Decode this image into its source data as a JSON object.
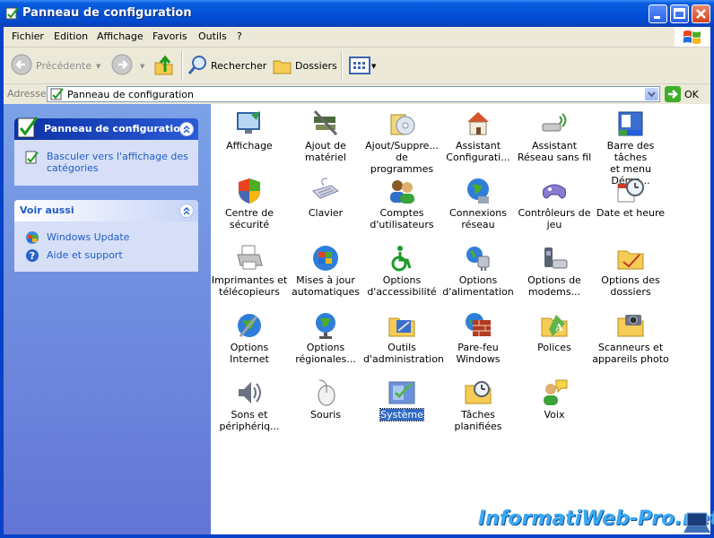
{
  "window": {
    "title": "Panneau de configuration"
  },
  "menu": [
    "Fichier",
    "Edition",
    "Affichage",
    "Favoris",
    "Outils",
    "?"
  ],
  "toolbar": {
    "back_label": "Précédente",
    "search_label": "Rechercher",
    "folders_label": "Dossiers"
  },
  "address": {
    "label": "Adresse",
    "value": "Panneau de configuration",
    "go_label": "OK"
  },
  "sidebar": {
    "control_panel": {
      "title": "Panneau de configuration",
      "link": "Basculer vers l'affichage des\ncatégories"
    },
    "see_also": {
      "title": "Voir aussi",
      "links": [
        "Windows Update",
        "Aide et support"
      ]
    }
  },
  "items": [
    "Affichage",
    "Ajout de\nmatériel",
    "Ajout/Suppre...\nde programmes",
    "Assistant\nConfigurati...",
    "Assistant\nRéseau sans fil",
    "Barre des tâches\net menu Déma...",
    "Centre de\nsécurité",
    "Clavier",
    "Comptes\nd'utilisateurs",
    "Connexions\nréseau",
    "Contrôleurs de\njeu",
    "Date et heure",
    "Imprimantes et\ntélécopieurs",
    "Mises à jour\nautomatiques",
    "Options\nd'accessibilité",
    "Options\nd'alimentation",
    "Options de\nmodems...",
    "Options des\ndossiers",
    "Options Internet",
    "Options\nrégionales...",
    "Outils\nd'administration",
    "Pare-feu\nWindows",
    "Polices",
    "Scanneurs et\nappareils photo",
    "Sons et\npériphériq...",
    "Souris",
    "Système",
    "Tâches\nplanifiées",
    "Voix"
  ],
  "selected_item": "Système",
  "watermark": "InformatiWeb-Pro.net",
  "colors": {
    "titlebar": "#0552d8",
    "sidebar": "#7ba2e7",
    "selection": "#316ac5",
    "link": "#215dc6"
  }
}
